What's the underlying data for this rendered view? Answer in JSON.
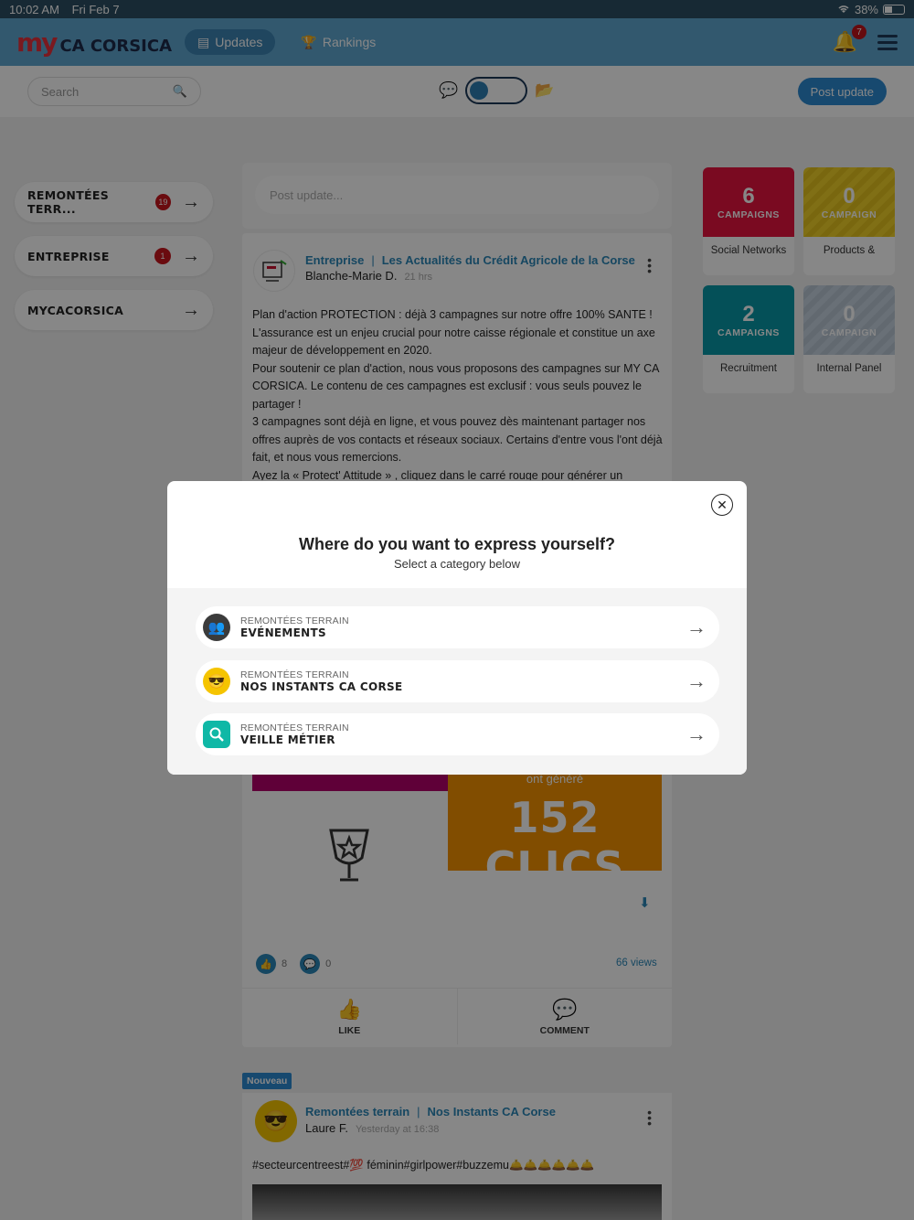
{
  "status_bar": {
    "time": "10:02 AM",
    "date": "Fri Feb 7",
    "battery": "38%"
  },
  "nav": {
    "logo_my": "my",
    "logo_brand": "CA CORSICA",
    "tabs": [
      {
        "label": "Updates",
        "active": true
      },
      {
        "label": "Rankings",
        "active": false
      }
    ],
    "notification_count": "7"
  },
  "toolbar": {
    "search_placeholder": "Search",
    "post_button": "Post update"
  },
  "sidebar": {
    "items": [
      {
        "label": "REMONTÉES TERR...",
        "badge": "19"
      },
      {
        "label": "ENTREPRISE",
        "badge": "1"
      },
      {
        "label": "MYCACORSICA",
        "badge": ""
      }
    ]
  },
  "composer": {
    "placeholder": "Post update..."
  },
  "post": {
    "category": "Entreprise",
    "group": "Les Actualités du Crédit Agricole de la Corse",
    "author": "Blanche-Marie D.",
    "time": "21 hrs",
    "body": "Plan d'action PROTECTION : déjà 3 campagnes sur notre offre 100% SANTE !\nL'assurance est un enjeu crucial pour notre caisse régionale et constitue un axe majeur de développement en 2020.\nPour soutenir ce plan d'action, nous vous proposons des campagnes sur MY CA CORSICA. Le contenu de ces campagnes est exclusif : vous seuls pouvez le partager !\n3 campagnes sont déjà en ligne, et vous pouvez dès maintenant partager nos offres auprès de vos contacts et réseaux sociaux. Certains d'entre vous l'ont déjà fait, et nous vous remercions.\nAyez la « Protect' Attitude » , cliquez dans le carré rouge pour générer un",
    "banner_generated": "ont généré",
    "banner_clicks": "152 CLICS",
    "likes": "8",
    "comments": "0",
    "views": "66 views",
    "like_label": "LIKE",
    "comment_label": "COMMENT"
  },
  "post2": {
    "tag": "Nouveau",
    "category": "Remontées terrain",
    "group": "Nos Instants CA Corse",
    "author": "Laure F.",
    "time": "Yesterday at 16:38",
    "body": "#secteurcentreest#💯 féminin#girlpower#buzzemu🛎️🛎️🛎️🛎️🛎️🛎️"
  },
  "campaigns": [
    {
      "count": "6",
      "unit": "CAMPAIGNS",
      "caption": "Social Networks",
      "color": "#e6133f"
    },
    {
      "count": "0",
      "unit": "CAMPAIGN",
      "caption": "Products &",
      "color": "#f2d229"
    },
    {
      "count": "2",
      "unit": "CAMPAIGNS",
      "caption": "Recruitment",
      "color": "#0897a7"
    },
    {
      "count": "0",
      "unit": "CAMPAIGN",
      "caption": "Internal Panel",
      "color": "#c7d3e0"
    }
  ],
  "modal": {
    "title": "Where do you want to express yourself?",
    "subtitle": "Select a category below",
    "options": [
      {
        "parent": "REMONTÉES TERRAIN",
        "name": "EVÉNEMENTS",
        "icon": "event-avatar-icon"
      },
      {
        "parent": "REMONTÉES TERRAIN",
        "name": "NOS INSTANTS CA CORSE",
        "icon": "minions-icon"
      },
      {
        "parent": "REMONTÉES TERRAIN",
        "name": "VEILLE MÉTIER",
        "icon": "search-icon"
      }
    ]
  }
}
